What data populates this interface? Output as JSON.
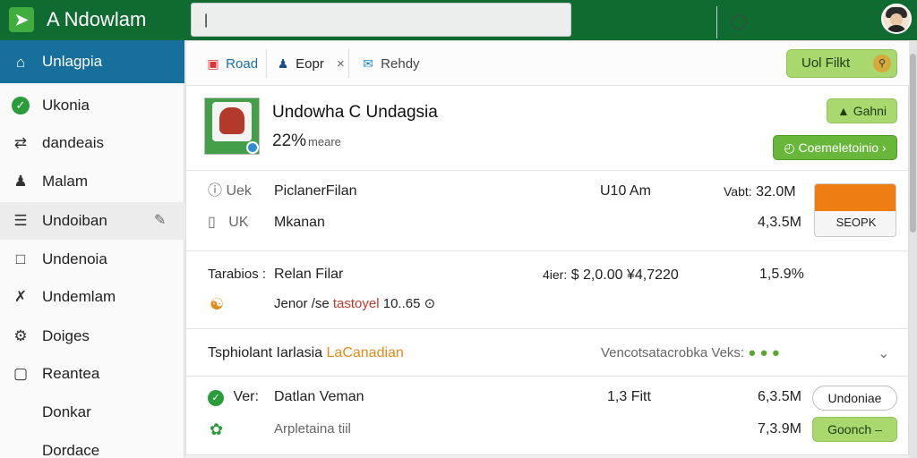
{
  "app": {
    "title": "A Ndowlam",
    "logo_glyph": "➤"
  },
  "search": {
    "value": "|",
    "placeholder": ""
  },
  "sidebar": {
    "items": [
      {
        "label": "Unlagpia",
        "icon": "home-icon"
      },
      {
        "label": "Ukonia",
        "icon": "check-circle-icon"
      },
      {
        "label": "dandeais",
        "icon": "share-icon"
      },
      {
        "label": "Malam",
        "icon": "user-icon"
      },
      {
        "label": "Undoiban",
        "icon": "document-icon"
      },
      {
        "label": "Undenoia",
        "icon": "bookmark-icon"
      },
      {
        "label": "Undemlam",
        "icon": "link-icon"
      },
      {
        "label": "Doiges",
        "icon": "gear-icon"
      },
      {
        "label": "Reantea",
        "icon": "folder-icon"
      },
      {
        "label": "Donkar",
        "icon": ""
      },
      {
        "label": "Dordace",
        "icon": ""
      }
    ]
  },
  "tabs": [
    {
      "label": "Road",
      "icon": "road-icon"
    },
    {
      "label": "Eopr",
      "icon": "person-icon"
    },
    {
      "label": "Rehdy",
      "icon": "mail-icon"
    }
  ],
  "filter": {
    "label": "Uol Filkt"
  },
  "product": {
    "title": "Undowha C Undagsia",
    "percent": "22%",
    "percent_suffix": "meare",
    "primary_button": "Gahni",
    "secondary_button": "Coemeletoinio"
  },
  "rows": {
    "r1": {
      "prefix": "Uek",
      "name": "PiclanerFilan",
      "time": "U10 Am",
      "stat_label": "Vabt:",
      "stat_value": "32.0M",
      "icon": "document-icon",
      "prefix2": "UK",
      "name2": "Mkanan",
      "value2": "4,3.5M",
      "card_label": "SEOPK"
    },
    "r2": {
      "prefix": "Tarabios :",
      "name": "Relan Filar",
      "price_label": "4ier:",
      "price_value": "$ 2,0.00 ¥4,7220",
      "pct": "1,5.9%",
      "sub_prefix": "Jenor /se",
      "sub_highlight": "tastoyel",
      "sub_suffix": "10..65",
      "sub_icon": "⊙"
    },
    "r3": {
      "title": "Tsphiolant Iarlasia",
      "title_highlight": "LaCanadian",
      "right_label": "Vencotsatacrobka Veks:",
      "right_glyphs": "● ● ●"
    },
    "r4": {
      "prefix": "Ver:",
      "name": "Datlan Veman",
      "mid": "1,3 Fitt",
      "value": "6,3.5M",
      "button": "Undoniae",
      "sub_name": "Arpletaina tiil",
      "sub_value": "7,3.9M",
      "sub_button": "Goonch"
    }
  },
  "colors": {
    "topbar": "#0f6b2f",
    "active_nav": "#17709b",
    "accent_green": "#a8d86e",
    "orange": "#ee7d12"
  }
}
